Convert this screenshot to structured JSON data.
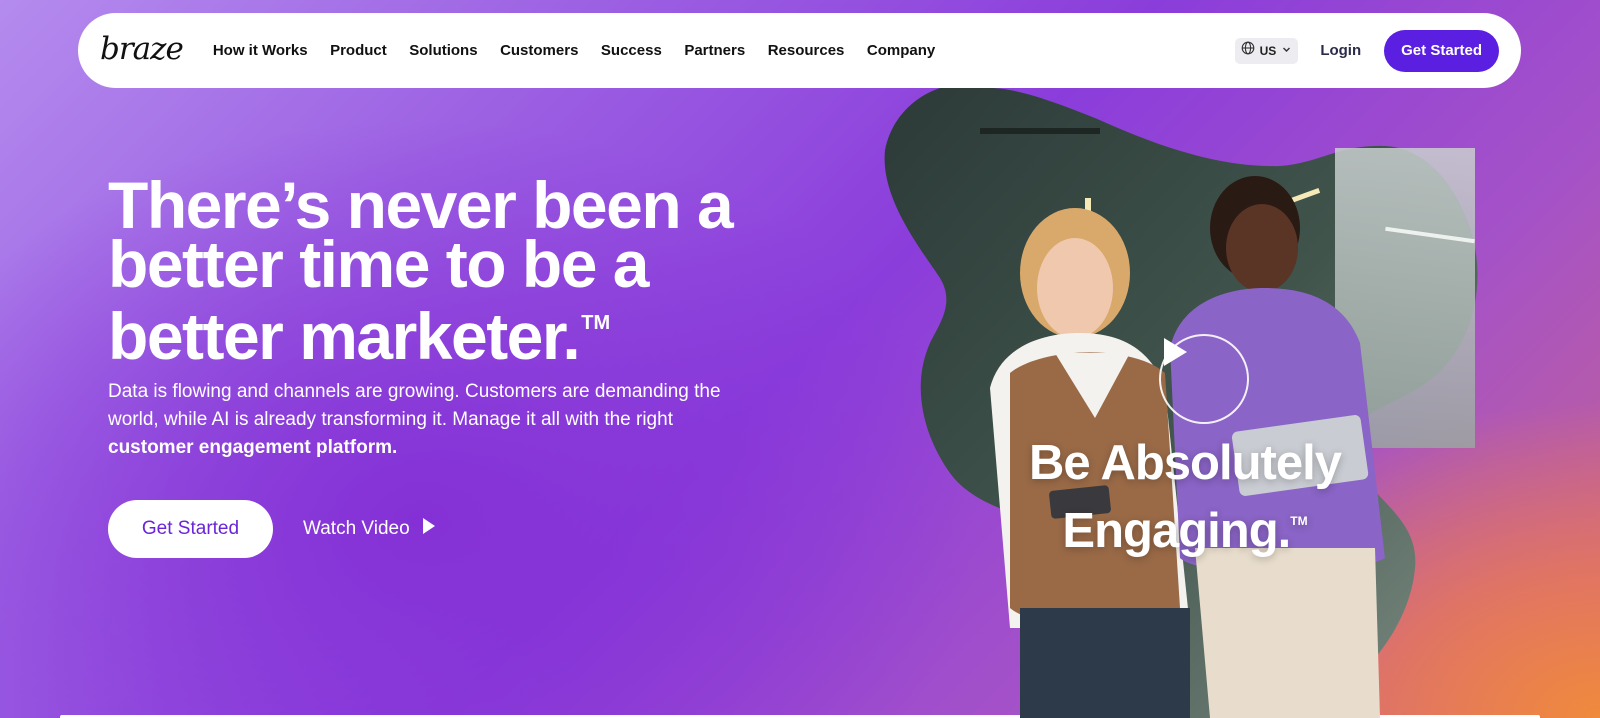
{
  "nav": {
    "logo": "braze",
    "links": [
      "How it Works",
      "Product",
      "Solutions",
      "Customers",
      "Success",
      "Partners",
      "Resources",
      "Company"
    ],
    "locale": "US",
    "login": "Login",
    "cta": "Get Started"
  },
  "hero": {
    "headline": "There’s never been a better time to be a better marketer.",
    "headline_mark": "TM",
    "subcopy": "Data is flowing and channels are growing. Customers are demanding the world, while AI is already transforming it. Manage it all with the right",
    "subcopy_bold": "customer engagement platform.",
    "primary_cta": "Get Started",
    "video_cta": "Watch Video"
  },
  "visual": {
    "tagline_line1": "Be Absolutely",
    "tagline_line2": "Engaging.",
    "tagline_mark": "TM",
    "icons": {
      "play": "play-icon",
      "locale": "globe-icon",
      "chevron": "chevron-down-icon"
    }
  },
  "colors": {
    "accent": "#5a1fe0",
    "cta_text": "#6a25d8",
    "gradient_purple": "#8430d6",
    "gradient_orange": "#f08a3c"
  }
}
